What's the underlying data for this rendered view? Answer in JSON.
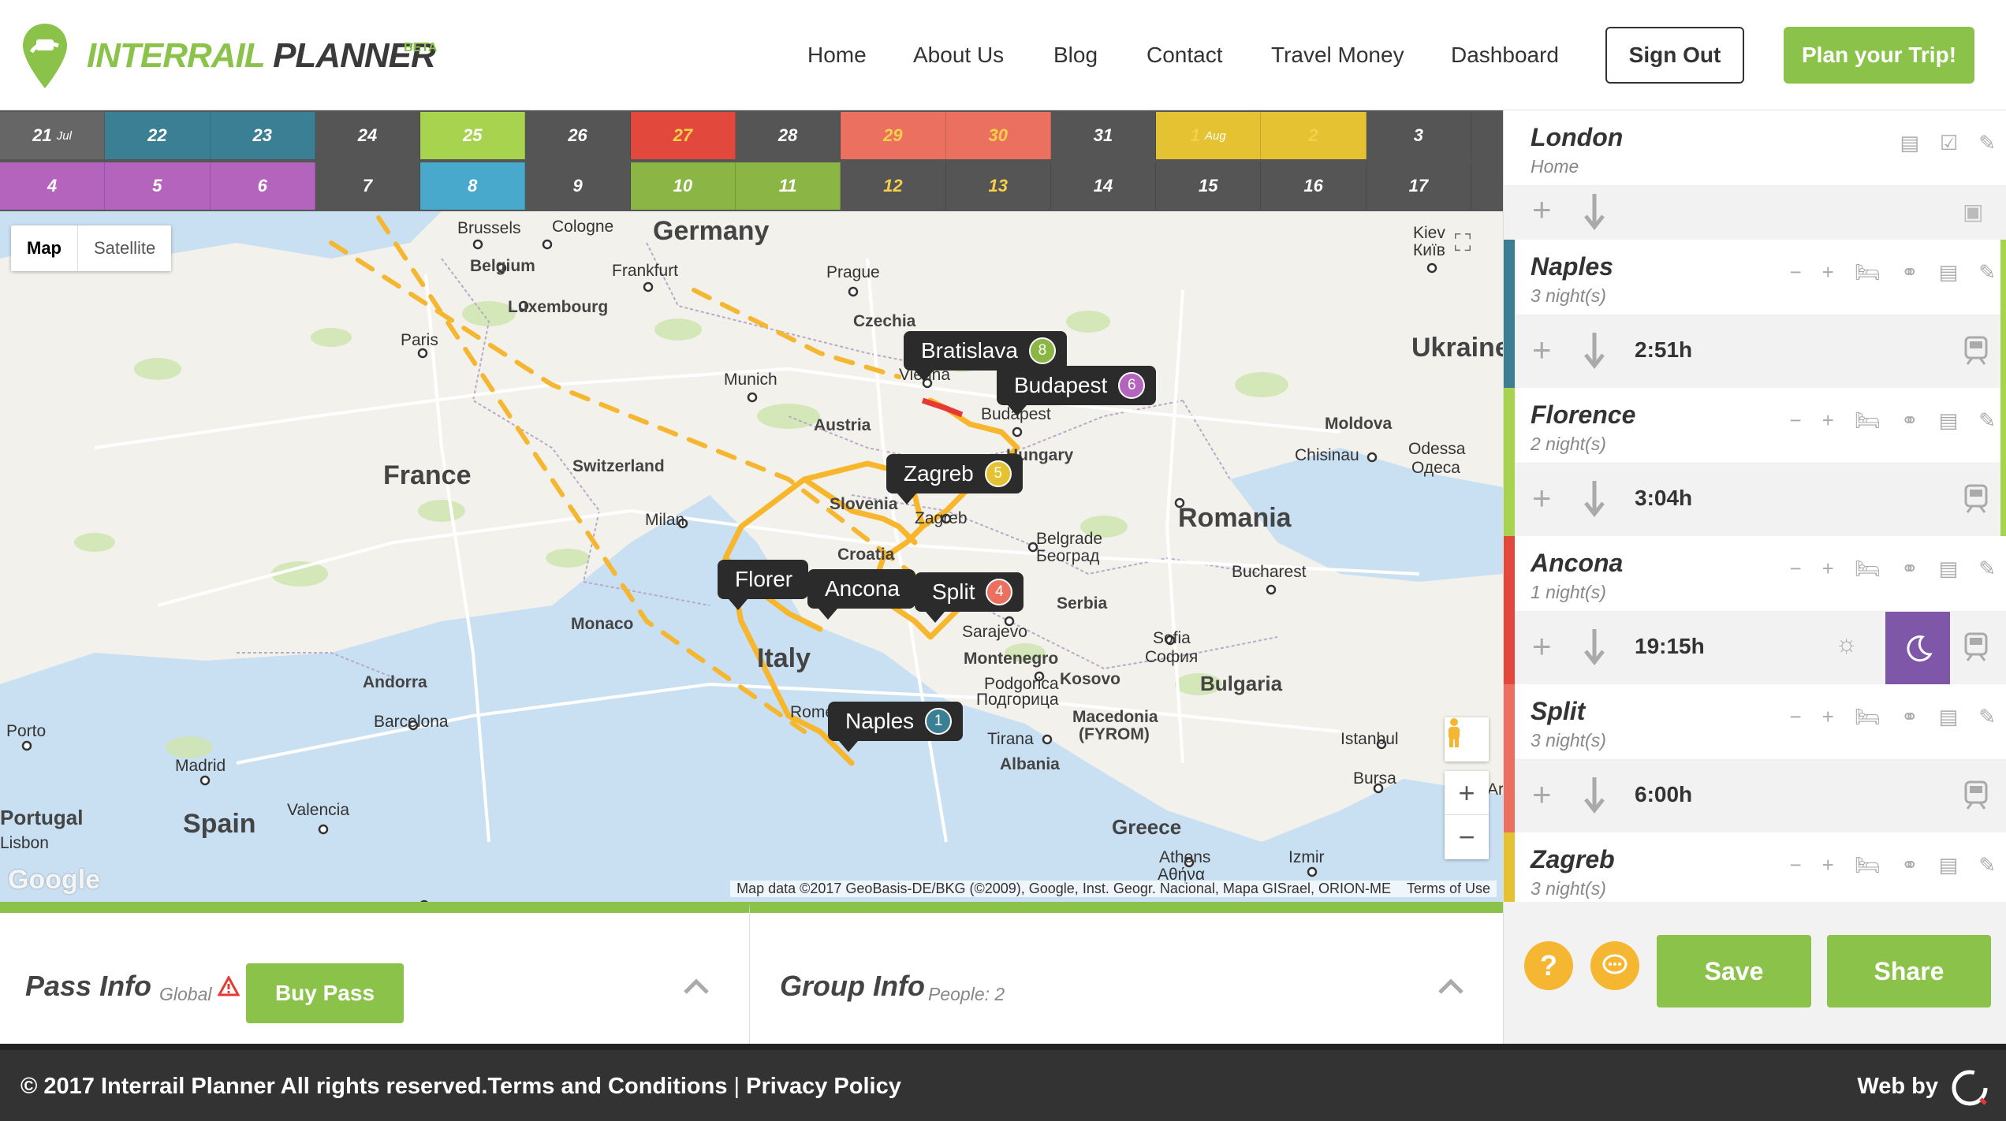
{
  "brand": {
    "name_part1": "INTERRAIL",
    "name_part2": " PLANNER",
    "badge": "BETA",
    "accent": "#8bc34a"
  },
  "nav": {
    "items": [
      "Home",
      "About Us",
      "Blog",
      "Contact",
      "Travel Money",
      "Dashboard"
    ],
    "sign_out": "Sign Out",
    "plan_trip": "Plan your Trip!"
  },
  "calendar": {
    "row1": [
      {
        "label": "21",
        "month": "Jul",
        "color": "#666666"
      },
      {
        "label": "22",
        "color": "#3a7f93"
      },
      {
        "label": "23",
        "color": "#3a7f93"
      },
      {
        "label": "24",
        "color": "#555555"
      },
      {
        "label": "25",
        "color": "#a8d34f"
      },
      {
        "label": "26",
        "color": "#555555"
      },
      {
        "label": "27",
        "color": "#e2493c"
      },
      {
        "label": "28",
        "color": "#555555"
      },
      {
        "label": "29",
        "color": "#ec7060"
      },
      {
        "label": "30",
        "color": "#ec7060"
      },
      {
        "label": "31",
        "color": "#555555"
      },
      {
        "label": "1",
        "month": "Aug",
        "color": "#e4c232"
      },
      {
        "label": "2",
        "color": "#e4c232"
      },
      {
        "label": "3",
        "color": "#555555"
      }
    ],
    "row2": [
      {
        "label": "4",
        "color": "#b564bd"
      },
      {
        "label": "5",
        "color": "#b564bd"
      },
      {
        "label": "6",
        "color": "#b564bd"
      },
      {
        "label": "7",
        "color": "#555555"
      },
      {
        "label": "8",
        "color": "#49a9cd"
      },
      {
        "label": "9",
        "color": "#555555"
      },
      {
        "label": "10",
        "color": "#8bb545"
      },
      {
        "label": "11",
        "color": "#8bb545"
      },
      {
        "label": "12",
        "color": "#555555"
      },
      {
        "label": "13",
        "color": "#555555"
      },
      {
        "label": "14",
        "color": "#555555"
      },
      {
        "label": "15",
        "color": "#555555"
      },
      {
        "label": "16",
        "color": "#555555"
      },
      {
        "label": "17",
        "color": "#555555"
      }
    ]
  },
  "map": {
    "type_map": "Map",
    "type_satellite": "Satellite",
    "labels": [
      "Brussels",
      "Cologne",
      "Germany",
      "Belgium",
      "Frankfurt",
      "Prague",
      "Luxembourg",
      "Czechia",
      "Paris",
      "Munich",
      "Vienna",
      "Austria",
      "Budapest",
      "France",
      "Switzerland",
      "Hungary",
      "Moldova",
      "Chisinau",
      "Odessa",
      "Одеса",
      "Slovenia",
      "Zagreb",
      "Romania",
      "Milan",
      "Croatia",
      "Belgrade",
      "Београд",
      "Bucharest",
      "Monaco",
      "Italy",
      "Serbia",
      "Sarajevo",
      "Montenegro",
      "Sofia",
      "София",
      "Kosovo",
      "Bulgaria",
      "Podgorica",
      "Подгорица",
      "Andorra",
      "Rome",
      "Macedonia",
      "(FYROM)",
      "Porto",
      "Barcelona",
      "Tirana",
      "Istanbul",
      "Albania",
      "Madrid",
      "Spain",
      "Valencia",
      "Bursa",
      "Portugal",
      "Lisbon",
      "Greece",
      "Athens",
      "Αθήνα",
      "Izmir",
      "Ukraine",
      "Kiev",
      "Київ",
      "Ar"
    ],
    "pins": [
      {
        "name": "Bratislava",
        "num": "8",
        "color": "#8bb545"
      },
      {
        "name": "Budapest",
        "num": "6",
        "color": "#b564bd"
      },
      {
        "name": "Zagreb",
        "num": "5",
        "color": "#e4c232"
      },
      {
        "name": "Florer",
        "num": "",
        "color": "#a8d34f"
      },
      {
        "name": "Ancona",
        "num": "",
        "color": "#e2493c"
      },
      {
        "name": "Split",
        "num": "4",
        "color": "#ec7060"
      },
      {
        "name": "Naples",
        "num": "1",
        "color": "#3a7f93"
      }
    ],
    "attribution": "Map data ©2017 GeoBasis-DE/BKG (©2009), Google, Inst. Geogr. Nacional, Mapa GISrael, ORION-ME",
    "terms": "Terms of Use",
    "google": "Google",
    "zoom_in": "+",
    "zoom_out": "−"
  },
  "itinerary": {
    "stops": [
      {
        "name": "London",
        "sub": "Home",
        "color": "#ffffff",
        "right": "#ffffff"
      },
      {
        "name": "Naples",
        "sub": "3 night(s)",
        "color": "#3a7f93",
        "right": "#a8d34f"
      },
      {
        "name": "Florence",
        "sub": "2 night(s)",
        "color": "#a8d34f",
        "right": "#a8d34f"
      },
      {
        "name": "Ancona",
        "sub": "1 night(s)",
        "color": "#e2493c",
        "right": "#ffffff"
      },
      {
        "name": "Split",
        "sub": "3 night(s)",
        "color": "#ec7060",
        "right": "#ffffff"
      },
      {
        "name": "Zagreb",
        "sub": "3 night(s)",
        "color": "#e4c232",
        "right": "#ffffff"
      }
    ],
    "legs": [
      {
        "time": ""
      },
      {
        "time": "2:51h"
      },
      {
        "time": "3:04h"
      },
      {
        "time": "19:15h"
      },
      {
        "time": "6:00h"
      }
    ]
  },
  "pass": {
    "title": "Pass Info",
    "scope": "Global",
    "buy": "Buy Pass"
  },
  "group": {
    "title": "Group Info",
    "people": "People: 2"
  },
  "actions": {
    "help": "?",
    "save": "Save",
    "share": "Share"
  },
  "footer": {
    "copyright": "© 2017 Interrail Planner All rights reserved.",
    "terms": "Terms and Conditions",
    "sep": " | ",
    "privacy": "Privacy Policy",
    "webby": "Web by"
  }
}
